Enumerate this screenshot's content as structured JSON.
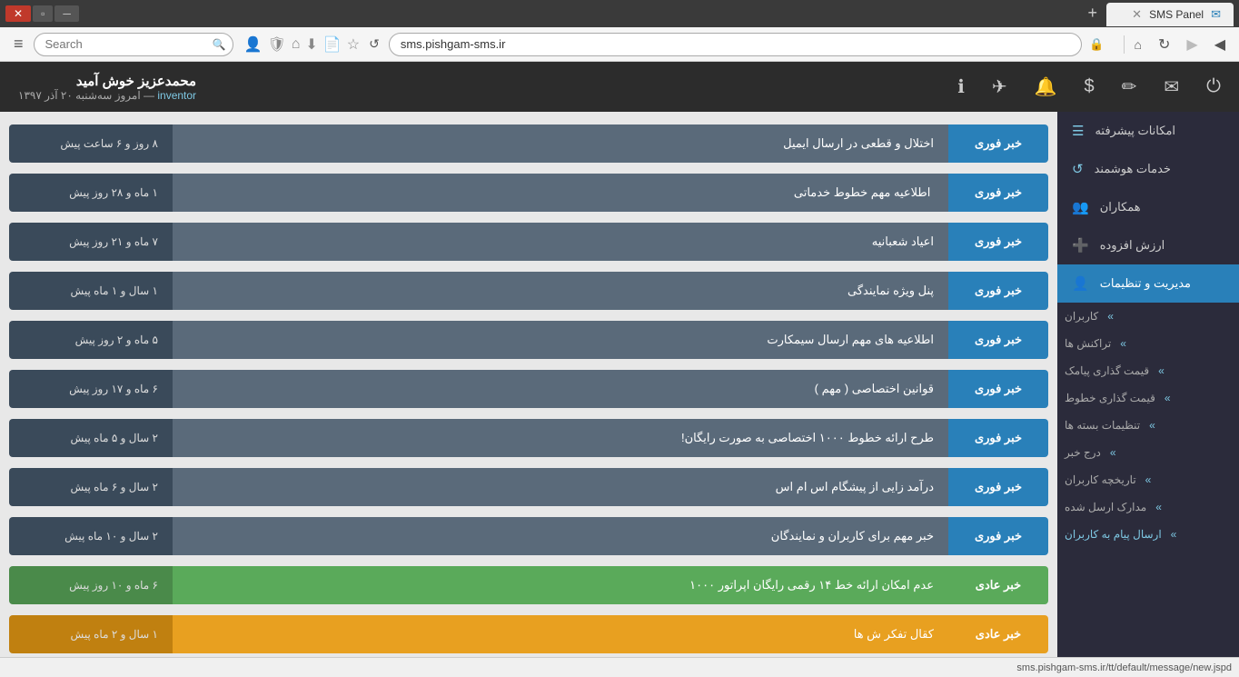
{
  "browser": {
    "tab_title": "SMS Panel",
    "address": "sms.pishgam-sms.ir",
    "search_placeholder": "Search",
    "search_value": "Search"
  },
  "toolbar": {
    "user_name": "محمدعزیز خوش آمید",
    "user_role": "inventor",
    "user_date": "امروز سه‌شنبه ۲۰ آذر ۱۳۹۷"
  },
  "sidebar": {
    "sections": [
      {
        "label": "امکانات پیشرفته",
        "icon": "☰",
        "key": "advanced"
      },
      {
        "label": "خدمات هوشمند",
        "icon": "↺",
        "key": "smart"
      },
      {
        "label": "همکاران",
        "icon": "👥",
        "key": "partners"
      },
      {
        "label": "ارزش افزوده",
        "icon": "➕",
        "key": "value"
      },
      {
        "label": "مدیریت و تنظیمات",
        "icon": "👤",
        "key": "management",
        "active": true
      }
    ],
    "sub_items": [
      "کاربران",
      "تراکنش ها",
      "قیمت گذاری پیامک",
      "قیمت گذاری خطوط",
      "تنظیمات بسته ها",
      "درج خبر",
      "تاریخچه کاربران",
      "مدارک ارسل شده",
      "ارسال پیام به کاربران"
    ]
  },
  "news": [
    {
      "badge": "خبر فوری",
      "type": "urgent",
      "title": "اختلال و قطعی در ارسال ایمیل",
      "date": "۸ روز و ۶ ساعت پیش"
    },
    {
      "badge": "خبر فوری",
      "type": "urgent",
      "title": "‌‌‌ اطلاعیه مهم خطوط خدماتی ‌‌‌",
      "date": "۱ ماه و ۲۸ روز پیش"
    },
    {
      "badge": "خبر فوری",
      "type": "urgent",
      "title": "اعیاد شعبانیه",
      "date": "۷ ماه و ۲۱ روز پیش"
    },
    {
      "badge": "خبر فوری",
      "type": "urgent",
      "title": "پنل ویژه نمایندگی",
      "date": "۱ سال و ۱ ماه پیش"
    },
    {
      "badge": "خبر فوری",
      "type": "urgent",
      "title": "اطلاعیه های مهم ارسال سیمکارت",
      "date": "۵ ماه و ۲ روز پیش"
    },
    {
      "badge": "خبر فوری",
      "type": "urgent",
      "title": "قوانین اختصاصی ( مهم )",
      "date": "۶ ماه و ۱۷ روز پیش"
    },
    {
      "badge": "خبر فوری",
      "type": "urgent",
      "title": "طرح ارائه خطوط ۱۰۰۰ اختصاصی به صورت رایگان!",
      "date": "۲ سال و ۵ ماه پیش"
    },
    {
      "badge": "خبر فوری",
      "type": "urgent",
      "title": "درآمد زایی از پیشگام اس ام اس",
      "date": "۲ سال و ۶ ماه پیش"
    },
    {
      "badge": "خبر فوری",
      "type": "urgent",
      "title": "خبر مهم برای کاربران و نمایندگان",
      "date": "۲ سال و ۱۰ ماه پیش"
    },
    {
      "badge": "خبر عادی",
      "type": "green",
      "title": "عدم امکان ارائه خط ۱۴ رقمی رایگان اپراتور ۱۰۰۰",
      "date": "۶ ماه و ۱۰ روز پیش"
    },
    {
      "badge": "خبر عادی",
      "type": "yellow",
      "title": "کقال تفکر ش ها",
      "date": "۱ سال و ۲ ماه پیش"
    }
  ],
  "statusbar": {
    "url": "sms.pishgam-sms.ir/tt/default/message/new.jspd"
  }
}
